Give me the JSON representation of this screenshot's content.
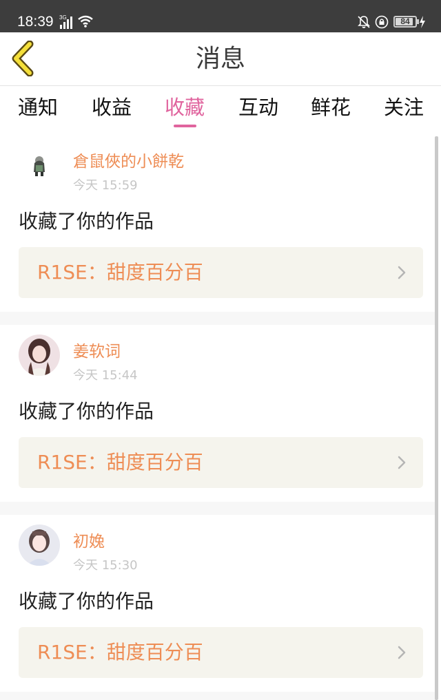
{
  "status_bar": {
    "time": "18:39",
    "network_label": "3G",
    "battery": "84",
    "colors": {
      "background": "#3d3d3d",
      "text": "#ffffff"
    }
  },
  "header": {
    "title": "消息",
    "back_icon": "chevron-left-icon",
    "colors": {
      "back_fill": "#f4df3a",
      "back_outline": "#5a4a14"
    }
  },
  "tabs": {
    "items": [
      {
        "label": "通知",
        "active": false
      },
      {
        "label": "收益",
        "active": false
      },
      {
        "label": "收藏",
        "active": true
      },
      {
        "label": "互动",
        "active": false
      },
      {
        "label": "鲜花",
        "active": false
      },
      {
        "label": "关注",
        "active": false
      }
    ],
    "colors": {
      "active": "#e0649e",
      "inactive": "#111111"
    }
  },
  "feed": {
    "items": [
      {
        "username": "倉鼠俠的小餅乾",
        "time": "今天 15:59",
        "action": "收藏了你的作品",
        "work_title": "R1SE：甜度百分百",
        "avatar": "avatar-illustration-boy"
      },
      {
        "username": "姜软词",
        "time": "今天 15:44",
        "action": "收藏了你的作品",
        "work_title": "R1SE：甜度百分百",
        "avatar": "avatar-photo-girl"
      },
      {
        "username": "初婏",
        "time": "今天 15:30",
        "action": "收藏了你的作品",
        "work_title": "R1SE：甜度百分百",
        "avatar": "avatar-photo-girl"
      }
    ],
    "colors": {
      "username": "#ee8d55",
      "timestamp": "#c6c6c6",
      "work_link_bg": "#f5f4ed",
      "divider": "#f7f7f7"
    }
  }
}
